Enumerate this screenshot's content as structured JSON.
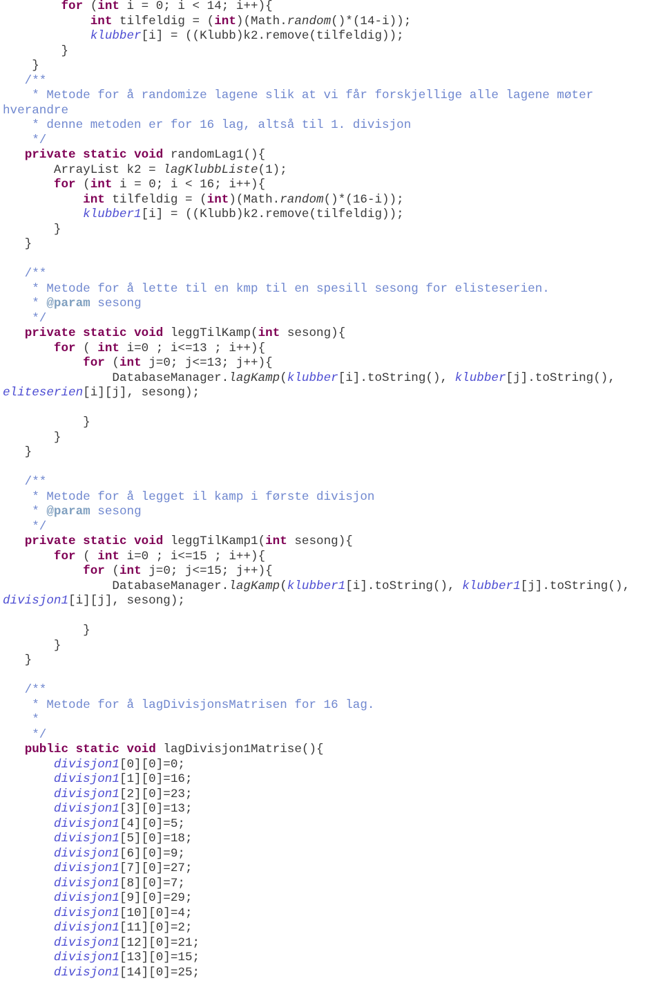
{
  "colors": {
    "keyword": "#7f0055",
    "comment": "#3f5fbf",
    "javadoc_tag": "#7f9fbf",
    "field": "#0000c0",
    "text": "#3a3a3a"
  },
  "lines": [
    [
      [
        "        ",
        "tx"
      ],
      [
        "for",
        "kw"
      ],
      [
        " (",
        "tx"
      ],
      [
        "int",
        "kw"
      ],
      [
        " i = 0; i < 14; i++){",
        "tx"
      ]
    ],
    [
      [
        "            ",
        "tx"
      ],
      [
        "int",
        "kw"
      ],
      [
        " tilfeldig = (",
        "tx"
      ],
      [
        "int",
        "kw"
      ],
      [
        ")(Math.",
        "tx"
      ],
      [
        "random",
        "st"
      ],
      [
        "()*(14-i));",
        "tx"
      ]
    ],
    [
      [
        "            ",
        "tx"
      ],
      [
        "klubber",
        "fld"
      ],
      [
        "[i] = ((Klubb)k2.remove(tilfeldig));",
        "tx"
      ]
    ],
    [
      [
        "        }",
        "tx"
      ]
    ],
    [
      [
        "    }",
        "tx"
      ]
    ],
    [
      [
        "   /**",
        "cm"
      ]
    ],
    [
      [
        "    * Metode for å randomize lagene slik at vi får forskjellige alle lagene møter",
        "cm"
      ]
    ],
    [
      [
        "hverandre",
        "cm"
      ]
    ],
    [
      [
        "    * denne metoden er for 16 lag, altså til 1. divisjon",
        "cm"
      ]
    ],
    [
      [
        "    */",
        "cm"
      ]
    ],
    [
      [
        "   ",
        "tx"
      ],
      [
        "private",
        "kw"
      ],
      [
        " ",
        "tx"
      ],
      [
        "static",
        "kw"
      ],
      [
        " ",
        "tx"
      ],
      [
        "void",
        "kw"
      ],
      [
        " randomLag1(){",
        "tx"
      ]
    ],
    [
      [
        "       ArrayList k2 = ",
        "tx"
      ],
      [
        "lagKlubbListe",
        "st"
      ],
      [
        "(1);",
        "tx"
      ]
    ],
    [
      [
        "       ",
        "tx"
      ],
      [
        "for",
        "kw"
      ],
      [
        " (",
        "tx"
      ],
      [
        "int",
        "kw"
      ],
      [
        " i = 0; i < 16; i++){",
        "tx"
      ]
    ],
    [
      [
        "           ",
        "tx"
      ],
      [
        "int",
        "kw"
      ],
      [
        " tilfeldig = (",
        "tx"
      ],
      [
        "int",
        "kw"
      ],
      [
        ")(Math.",
        "tx"
      ],
      [
        "random",
        "st"
      ],
      [
        "()*(16-i));",
        "tx"
      ]
    ],
    [
      [
        "           ",
        "tx"
      ],
      [
        "klubber1",
        "fld"
      ],
      [
        "[i] = ((Klubb)k2.remove(tilfeldig));",
        "tx"
      ]
    ],
    [
      [
        "       }",
        "tx"
      ]
    ],
    [
      [
        "   }",
        "tx"
      ]
    ],
    [
      [
        "",
        "tx"
      ]
    ],
    [
      [
        "   /**",
        "cm"
      ]
    ],
    [
      [
        "    * Metode for å lette til en kmp til en spesill sesong for elisteserien.",
        "cm"
      ]
    ],
    [
      [
        "    * ",
        "cm"
      ],
      [
        "@param",
        "tag"
      ],
      [
        " sesong",
        "cm"
      ]
    ],
    [
      [
        "    */",
        "cm"
      ]
    ],
    [
      [
        "   ",
        "tx"
      ],
      [
        "private",
        "kw"
      ],
      [
        " ",
        "tx"
      ],
      [
        "static",
        "kw"
      ],
      [
        " ",
        "tx"
      ],
      [
        "void",
        "kw"
      ],
      [
        " leggTilKamp(",
        "tx"
      ],
      [
        "int",
        "kw"
      ],
      [
        " sesong){",
        "tx"
      ]
    ],
    [
      [
        "       ",
        "tx"
      ],
      [
        "for",
        "kw"
      ],
      [
        " ( ",
        "tx"
      ],
      [
        "int",
        "kw"
      ],
      [
        " i=0 ; i<=13 ; i++){",
        "tx"
      ]
    ],
    [
      [
        "           ",
        "tx"
      ],
      [
        "for",
        "kw"
      ],
      [
        " (",
        "tx"
      ],
      [
        "int",
        "kw"
      ],
      [
        " j=0; j<=13; j++){",
        "tx"
      ]
    ],
    [
      [
        "               DatabaseManager.",
        "tx"
      ],
      [
        "lagKamp",
        "st"
      ],
      [
        "(",
        "tx"
      ],
      [
        "klubber",
        "fld"
      ],
      [
        "[i].toString(), ",
        "tx"
      ],
      [
        "klubber",
        "fld"
      ],
      [
        "[j].toString(),",
        "tx"
      ]
    ],
    [
      [
        "eliteserien",
        "fld"
      ],
      [
        "[i][j], sesong);",
        "tx"
      ]
    ],
    [
      [
        "",
        "tx"
      ]
    ],
    [
      [
        "           }",
        "tx"
      ]
    ],
    [
      [
        "       }",
        "tx"
      ]
    ],
    [
      [
        "   }",
        "tx"
      ]
    ],
    [
      [
        "",
        "tx"
      ]
    ],
    [
      [
        "   /**",
        "cm"
      ]
    ],
    [
      [
        "    * Metode for å legget il kamp i første divisjon",
        "cm"
      ]
    ],
    [
      [
        "    * ",
        "cm"
      ],
      [
        "@param",
        "tag"
      ],
      [
        " sesong",
        "cm"
      ]
    ],
    [
      [
        "    */",
        "cm"
      ]
    ],
    [
      [
        "   ",
        "tx"
      ],
      [
        "private",
        "kw"
      ],
      [
        " ",
        "tx"
      ],
      [
        "static",
        "kw"
      ],
      [
        " ",
        "tx"
      ],
      [
        "void",
        "kw"
      ],
      [
        " leggTilKamp1(",
        "tx"
      ],
      [
        "int",
        "kw"
      ],
      [
        " sesong){",
        "tx"
      ]
    ],
    [
      [
        "       ",
        "tx"
      ],
      [
        "for",
        "kw"
      ],
      [
        " ( ",
        "tx"
      ],
      [
        "int",
        "kw"
      ],
      [
        " i=0 ; i<=15 ; i++){",
        "tx"
      ]
    ],
    [
      [
        "           ",
        "tx"
      ],
      [
        "for",
        "kw"
      ],
      [
        " (",
        "tx"
      ],
      [
        "int",
        "kw"
      ],
      [
        " j=0; j<=15; j++){",
        "tx"
      ]
    ],
    [
      [
        "               DatabaseManager.",
        "tx"
      ],
      [
        "lagKamp",
        "st"
      ],
      [
        "(",
        "tx"
      ],
      [
        "klubber1",
        "fld"
      ],
      [
        "[i].toString(), ",
        "tx"
      ],
      [
        "klubber1",
        "fld"
      ],
      [
        "[j].toString(),",
        "tx"
      ]
    ],
    [
      [
        "divisjon1",
        "fld"
      ],
      [
        "[i][j], sesong);",
        "tx"
      ]
    ],
    [
      [
        "",
        "tx"
      ]
    ],
    [
      [
        "           }",
        "tx"
      ]
    ],
    [
      [
        "       }",
        "tx"
      ]
    ],
    [
      [
        "   }",
        "tx"
      ]
    ],
    [
      [
        "",
        "tx"
      ]
    ],
    [
      [
        "   /**",
        "cm"
      ]
    ],
    [
      [
        "    * Metode for å lagDivisjonsMatrisen for 16 lag.",
        "cm"
      ]
    ],
    [
      [
        "    *",
        "cm"
      ]
    ],
    [
      [
        "    */",
        "cm"
      ]
    ],
    [
      [
        "   ",
        "tx"
      ],
      [
        "public",
        "kw"
      ],
      [
        " ",
        "tx"
      ],
      [
        "static",
        "kw"
      ],
      [
        " ",
        "tx"
      ],
      [
        "void",
        "kw"
      ],
      [
        " lagDivisjon1Matrise(){",
        "tx"
      ]
    ],
    [
      [
        "       ",
        "tx"
      ],
      [
        "divisjon1",
        "fld"
      ],
      [
        "[0][0]=0;",
        "tx"
      ]
    ],
    [
      [
        "       ",
        "tx"
      ],
      [
        "divisjon1",
        "fld"
      ],
      [
        "[1][0]=16;",
        "tx"
      ]
    ],
    [
      [
        "       ",
        "tx"
      ],
      [
        "divisjon1",
        "fld"
      ],
      [
        "[2][0]=23;",
        "tx"
      ]
    ],
    [
      [
        "       ",
        "tx"
      ],
      [
        "divisjon1",
        "fld"
      ],
      [
        "[3][0]=13;",
        "tx"
      ]
    ],
    [
      [
        "       ",
        "tx"
      ],
      [
        "divisjon1",
        "fld"
      ],
      [
        "[4][0]=5;",
        "tx"
      ]
    ],
    [
      [
        "       ",
        "tx"
      ],
      [
        "divisjon1",
        "fld"
      ],
      [
        "[5][0]=18;",
        "tx"
      ]
    ],
    [
      [
        "       ",
        "tx"
      ],
      [
        "divisjon1",
        "fld"
      ],
      [
        "[6][0]=9;",
        "tx"
      ]
    ],
    [
      [
        "       ",
        "tx"
      ],
      [
        "divisjon1",
        "fld"
      ],
      [
        "[7][0]=27;",
        "tx"
      ]
    ],
    [
      [
        "       ",
        "tx"
      ],
      [
        "divisjon1",
        "fld"
      ],
      [
        "[8][0]=7;",
        "tx"
      ]
    ],
    [
      [
        "       ",
        "tx"
      ],
      [
        "divisjon1",
        "fld"
      ],
      [
        "[9][0]=29;",
        "tx"
      ]
    ],
    [
      [
        "       ",
        "tx"
      ],
      [
        "divisjon1",
        "fld"
      ],
      [
        "[10][0]=4;",
        "tx"
      ]
    ],
    [
      [
        "       ",
        "tx"
      ],
      [
        "divisjon1",
        "fld"
      ],
      [
        "[11][0]=2;",
        "tx"
      ]
    ],
    [
      [
        "       ",
        "tx"
      ],
      [
        "divisjon1",
        "fld"
      ],
      [
        "[12][0]=21;",
        "tx"
      ]
    ],
    [
      [
        "       ",
        "tx"
      ],
      [
        "divisjon1",
        "fld"
      ],
      [
        "[13][0]=15;",
        "tx"
      ]
    ],
    [
      [
        "       ",
        "tx"
      ],
      [
        "divisjon1",
        "fld"
      ],
      [
        "[14][0]=25;",
        "tx"
      ]
    ]
  ]
}
